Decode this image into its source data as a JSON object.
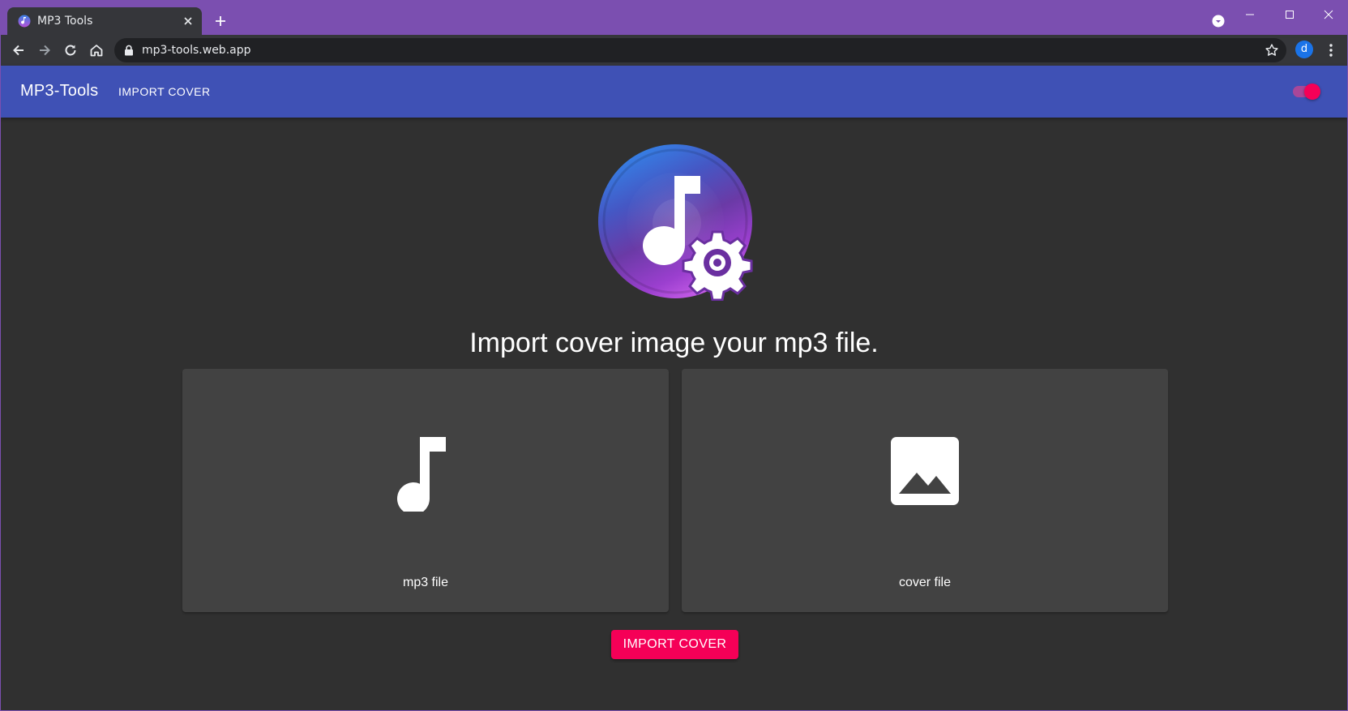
{
  "browser": {
    "tab_title": "MP3 Tools",
    "url": "mp3-tools.web.app",
    "profile_initial": "d",
    "frame_color": "#7b4fb0"
  },
  "appbar": {
    "brand": "MP3-Tools",
    "nav_link": "IMPORT COVER",
    "background": "#3f51b5",
    "theme_toggle_on": true
  },
  "main": {
    "logo_icon": "music-note-gear-icon",
    "headline": "Import cover image your mp3 file.",
    "cards": [
      {
        "label": "mp3 file",
        "icon": "music-note-icon"
      },
      {
        "label": "cover file",
        "icon": "image-icon"
      }
    ],
    "import_button": "IMPORT COVER",
    "accent": "#f50057"
  }
}
